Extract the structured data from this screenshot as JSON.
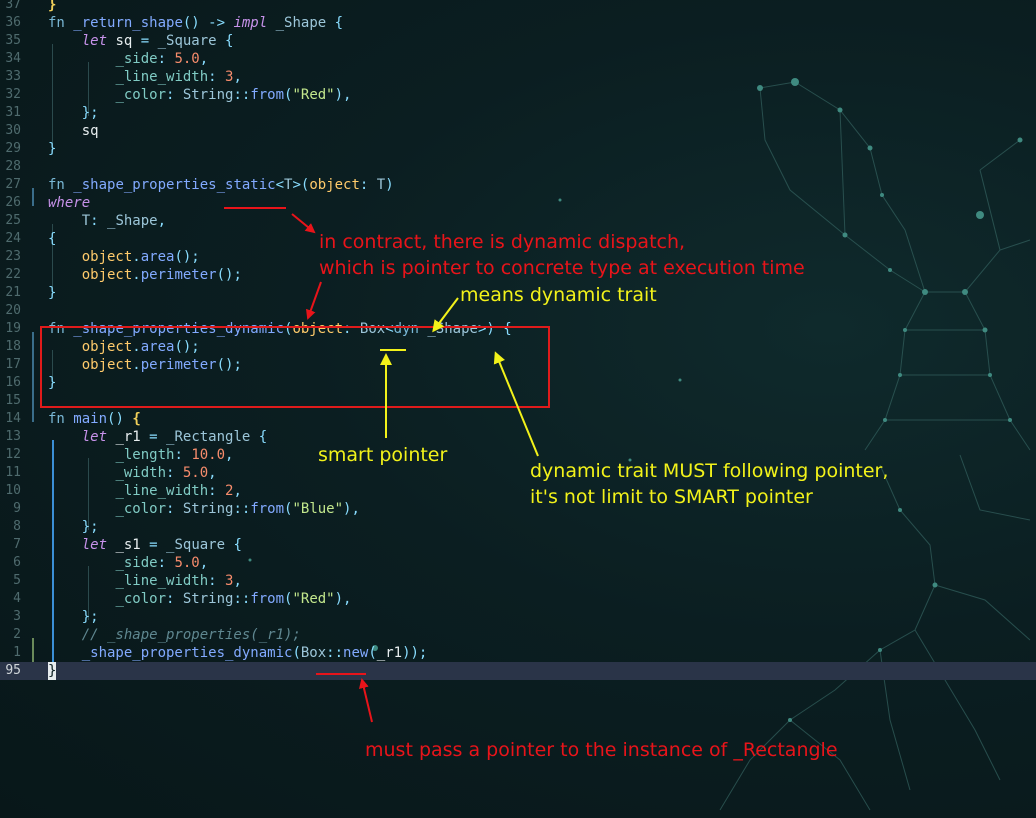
{
  "colors": {
    "annotation_red": "#e8141a",
    "annotation_yellow": "#f2f21a",
    "current_line": "#2a3448"
  },
  "lines": [
    {
      "num": "37",
      "tokens": [
        [
          "br",
          "}"
        ]
      ]
    },
    {
      "num": "36",
      "tokens": [
        [
          "kw",
          "fn "
        ],
        [
          "fn",
          "_return_shape"
        ],
        [
          "p",
          "() -> "
        ],
        [
          "kwi",
          "impl"
        ],
        [
          "v",
          " "
        ],
        [
          "ty",
          "_Shape"
        ],
        [
          "p",
          " {"
        ]
      ]
    },
    {
      "num": "35",
      "tokens": [
        [
          "v",
          "    "
        ],
        [
          "kwi",
          "let"
        ],
        [
          "v",
          " sq "
        ],
        [
          "p",
          "= "
        ],
        [
          "ty",
          "_Square"
        ],
        [
          "p",
          " {"
        ]
      ]
    },
    {
      "num": "34",
      "tokens": [
        [
          "v",
          "        "
        ],
        [
          "fld",
          "_side"
        ],
        [
          "p",
          ": "
        ],
        [
          "num",
          "5.0"
        ],
        [
          "p",
          ","
        ]
      ]
    },
    {
      "num": "33",
      "tokens": [
        [
          "v",
          "        "
        ],
        [
          "fld",
          "_line_width"
        ],
        [
          "p",
          ": "
        ],
        [
          "num",
          "3"
        ],
        [
          "p",
          ","
        ]
      ]
    },
    {
      "num": "32",
      "tokens": [
        [
          "v",
          "        "
        ],
        [
          "fld",
          "_color"
        ],
        [
          "p",
          ": "
        ],
        [
          "ty",
          "String"
        ],
        [
          "p",
          "::"
        ],
        [
          "fn",
          "from"
        ],
        [
          "p",
          "("
        ],
        [
          "str",
          "\"Red\""
        ],
        [
          "p",
          "),"
        ]
      ]
    },
    {
      "num": "31",
      "tokens": [
        [
          "v",
          "    "
        ],
        [
          "p",
          "};"
        ]
      ]
    },
    {
      "num": "30",
      "tokens": [
        [
          "v",
          "    sq"
        ]
      ]
    },
    {
      "num": "29",
      "tokens": [
        [
          "p",
          "}"
        ]
      ]
    },
    {
      "num": "28",
      "tokens": []
    },
    {
      "num": "27",
      "tokens": [
        [
          "kw",
          "fn "
        ],
        [
          "fn",
          "_shape_properties_static"
        ],
        [
          "p",
          "<"
        ],
        [
          "ty",
          "T"
        ],
        [
          "p",
          ">("
        ],
        [
          "y",
          "object"
        ],
        [
          "p",
          ": "
        ],
        [
          "ty",
          "T"
        ],
        [
          "p",
          ")"
        ]
      ]
    },
    {
      "num": "26",
      "tokens": [
        [
          "kwi",
          "where"
        ]
      ]
    },
    {
      "num": "25",
      "tokens": [
        [
          "v",
          "    "
        ],
        [
          "ty",
          "T"
        ],
        [
          "p",
          ": "
        ],
        [
          "ty",
          "_Shape"
        ],
        [
          "p",
          ","
        ]
      ]
    },
    {
      "num": "24",
      "tokens": [
        [
          "p",
          "{"
        ]
      ]
    },
    {
      "num": "23",
      "tokens": [
        [
          "v",
          "    "
        ],
        [
          "y",
          "object"
        ],
        [
          "p",
          "."
        ],
        [
          "fn",
          "area"
        ],
        [
          "p",
          "();"
        ]
      ]
    },
    {
      "num": "22",
      "tokens": [
        [
          "v",
          "    "
        ],
        [
          "y",
          "object"
        ],
        [
          "p",
          "."
        ],
        [
          "fn",
          "perimeter"
        ],
        [
          "p",
          "();"
        ]
      ]
    },
    {
      "num": "21",
      "tokens": [
        [
          "p",
          "}"
        ]
      ]
    },
    {
      "num": "20",
      "tokens": []
    },
    {
      "num": "19",
      "tokens": [
        [
          "kw",
          "fn "
        ],
        [
          "fn",
          "_shape_properties_dynamic"
        ],
        [
          "p",
          "("
        ],
        [
          "y",
          "object"
        ],
        [
          "p",
          ": "
        ],
        [
          "ty",
          "Box"
        ],
        [
          "p",
          "<"
        ],
        [
          "kw",
          "dyn"
        ],
        [
          "v",
          " "
        ],
        [
          "ty",
          "_Shape"
        ],
        [
          "p",
          ">) {"
        ]
      ]
    },
    {
      "num": "18",
      "tokens": [
        [
          "v",
          "    "
        ],
        [
          "y",
          "object"
        ],
        [
          "p",
          "."
        ],
        [
          "fn",
          "area"
        ],
        [
          "p",
          "();"
        ]
      ]
    },
    {
      "num": "17",
      "tokens": [
        [
          "v",
          "    "
        ],
        [
          "y",
          "object"
        ],
        [
          "p",
          "."
        ],
        [
          "fn",
          "perimeter"
        ],
        [
          "p",
          "();"
        ]
      ]
    },
    {
      "num": "16",
      "tokens": [
        [
          "p",
          "}"
        ]
      ]
    },
    {
      "num": "15",
      "tokens": []
    },
    {
      "num": "14",
      "tokens": [
        [
          "kw",
          "fn "
        ],
        [
          "fn",
          "main"
        ],
        [
          "p",
          "() "
        ],
        [
          "br",
          "{"
        ]
      ]
    },
    {
      "num": "13",
      "tokens": [
        [
          "v",
          "    "
        ],
        [
          "kwi",
          "let"
        ],
        [
          "v",
          " _r1 "
        ],
        [
          "p",
          "= "
        ],
        [
          "ty",
          "_Rectangle"
        ],
        [
          "p",
          " {"
        ]
      ]
    },
    {
      "num": "12",
      "tokens": [
        [
          "v",
          "        "
        ],
        [
          "fld",
          "_length"
        ],
        [
          "p",
          ": "
        ],
        [
          "num",
          "10.0"
        ],
        [
          "p",
          ","
        ]
      ]
    },
    {
      "num": "11",
      "tokens": [
        [
          "v",
          "        "
        ],
        [
          "fld",
          "_width"
        ],
        [
          "p",
          ": "
        ],
        [
          "num",
          "5.0"
        ],
        [
          "p",
          ","
        ]
      ]
    },
    {
      "num": "10",
      "tokens": [
        [
          "v",
          "        "
        ],
        [
          "fld",
          "_line_width"
        ],
        [
          "p",
          ": "
        ],
        [
          "num",
          "2"
        ],
        [
          "p",
          ","
        ]
      ]
    },
    {
      "num": "9",
      "tokens": [
        [
          "v",
          "        "
        ],
        [
          "fld",
          "_color"
        ],
        [
          "p",
          ": "
        ],
        [
          "ty",
          "String"
        ],
        [
          "p",
          "::"
        ],
        [
          "fn",
          "from"
        ],
        [
          "p",
          "("
        ],
        [
          "str",
          "\"Blue\""
        ],
        [
          "p",
          "),"
        ]
      ]
    },
    {
      "num": "8",
      "tokens": [
        [
          "v",
          "    "
        ],
        [
          "p",
          "};"
        ]
      ]
    },
    {
      "num": "7",
      "tokens": [
        [
          "v",
          "    "
        ],
        [
          "kwi",
          "let"
        ],
        [
          "v",
          " _s1 "
        ],
        [
          "p",
          "= "
        ],
        [
          "ty",
          "_Square"
        ],
        [
          "p",
          " {"
        ]
      ]
    },
    {
      "num": "6",
      "tokens": [
        [
          "v",
          "        "
        ],
        [
          "fld",
          "_side"
        ],
        [
          "p",
          ": "
        ],
        [
          "num",
          "5.0"
        ],
        [
          "p",
          ","
        ]
      ]
    },
    {
      "num": "5",
      "tokens": [
        [
          "v",
          "        "
        ],
        [
          "fld",
          "_line_width"
        ],
        [
          "p",
          ": "
        ],
        [
          "num",
          "3"
        ],
        [
          "p",
          ","
        ]
      ]
    },
    {
      "num": "4",
      "tokens": [
        [
          "v",
          "        "
        ],
        [
          "fld",
          "_color"
        ],
        [
          "p",
          ": "
        ],
        [
          "ty",
          "String"
        ],
        [
          "p",
          "::"
        ],
        [
          "fn",
          "from"
        ],
        [
          "p",
          "("
        ],
        [
          "str",
          "\"Red\""
        ],
        [
          "p",
          "),"
        ]
      ]
    },
    {
      "num": "3",
      "tokens": [
        [
          "v",
          "    "
        ],
        [
          "p",
          "};"
        ]
      ]
    },
    {
      "num": "2",
      "tokens": [
        [
          "v",
          "    "
        ],
        [
          "cm",
          "// _shape_properties(_r1);"
        ]
      ]
    },
    {
      "num": "1",
      "tokens": [
        [
          "v",
          "    "
        ],
        [
          "fn",
          "_shape_properties_dynamic"
        ],
        [
          "p",
          "("
        ],
        [
          "ty",
          "Box"
        ],
        [
          "p",
          "::"
        ],
        [
          "fn",
          "new"
        ],
        [
          "p",
          "("
        ],
        [
          "v",
          "_r1"
        ],
        [
          "p",
          "));"
        ]
      ]
    },
    {
      "num": "95",
      "tokens": [
        [
          "cur",
          "}"
        ]
      ],
      "current": true
    }
  ],
  "annotations": {
    "dispatch": "in contract, there is dynamic dispatch,\nwhich is pointer to concrete type at execution time",
    "means_dyn": "means dynamic trait",
    "smart_pointer": "smart pointer",
    "must_follow": "dynamic trait MUST following pointer,\nit's not limit to SMART pointer",
    "must_pass": "must pass a pointer to the instance of _Rectangle"
  }
}
